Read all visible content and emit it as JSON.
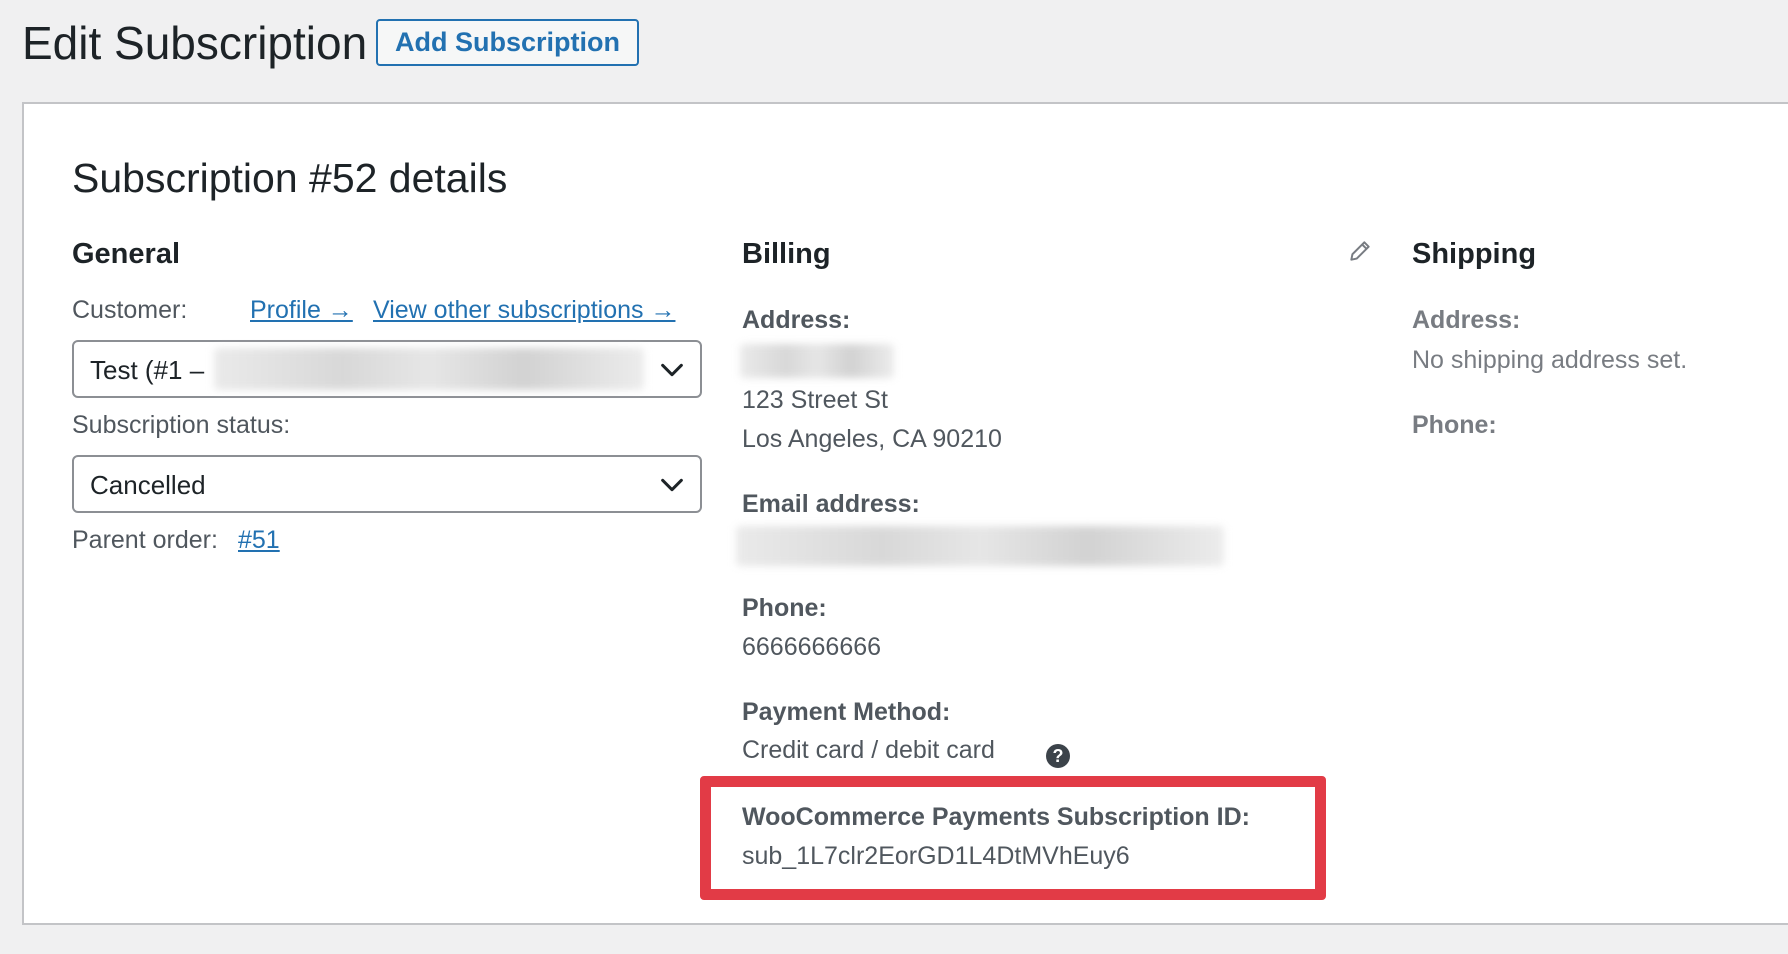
{
  "header": {
    "title": "Edit Subscription",
    "add_button": "Add Subscription"
  },
  "panel": {
    "title": "Subscription #52 details"
  },
  "general": {
    "heading": "General",
    "customer_label": "Customer:",
    "profile_link": "Profile →",
    "other_subscriptions_link": "View other subscriptions →",
    "customer_value": "Test (#1 –",
    "status_label": "Subscription status:",
    "status_value": "Cancelled",
    "parent_order_label": "Parent order:",
    "parent_order_link": "#51"
  },
  "billing": {
    "heading": "Billing",
    "address_label": "Address:",
    "address_line1": "123 Street St",
    "address_line2": "Los Angeles, CA 90210",
    "email_label": "Email address:",
    "phone_label": "Phone:",
    "phone_value": "6666666666",
    "payment_label": "Payment Method:",
    "payment_value": "Credit card / debit card",
    "help_glyph": "?",
    "sub_id_label": "WooCommerce Payments Subscription ID:",
    "sub_id_value": "sub_1L7clr2EorGD1L4DtMVhEuy6"
  },
  "shipping": {
    "heading": "Shipping",
    "address_label": "Address:",
    "address_value": "No shipping address set.",
    "phone_label": "Phone:"
  },
  "colors": {
    "accent": "#2271b1",
    "highlight": "#e23b46"
  }
}
